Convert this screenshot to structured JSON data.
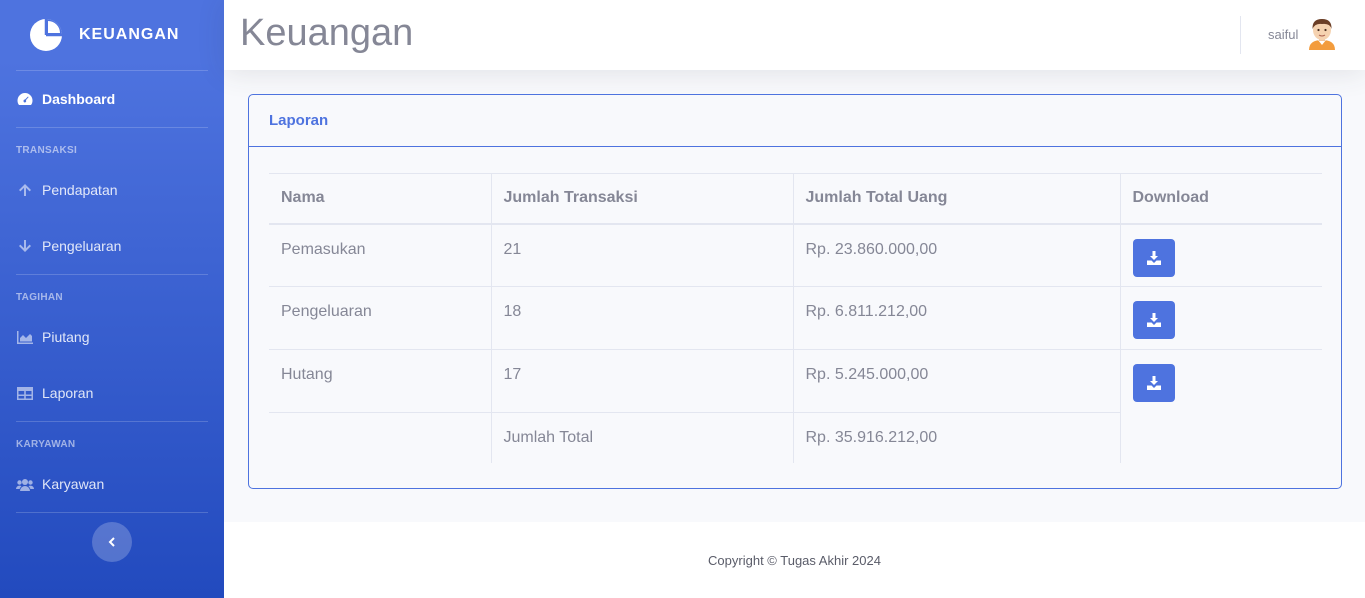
{
  "brand": {
    "name": "KEUANGAN",
    "icon": "pie-chart-icon"
  },
  "sidebar": {
    "dashboard": {
      "label": "Dashboard",
      "icon": "tachometer-icon"
    },
    "sections": [
      {
        "heading": "TRANSAKSI",
        "items": [
          {
            "label": "Pendapatan",
            "icon": "arrow-up-icon"
          },
          {
            "label": "Pengeluaran",
            "icon": "arrow-down-icon"
          }
        ]
      },
      {
        "heading": "TAGIHAN",
        "items": [
          {
            "label": "Piutang",
            "icon": "area-chart-icon"
          },
          {
            "label": "Laporan",
            "icon": "table-icon"
          }
        ]
      },
      {
        "heading": "KARYAWAN",
        "items": [
          {
            "label": "Karyawan",
            "icon": "users-icon"
          }
        ]
      }
    ],
    "toggle_icon": "chevron-left-icon"
  },
  "header": {
    "title": "Keuangan",
    "user_name": "saiful"
  },
  "card": {
    "title": "Laporan",
    "columns": [
      "Nama",
      "Jumlah Transaksi",
      "Jumlah Total Uang",
      "Download"
    ],
    "rows": [
      {
        "nama": "Pemasukan",
        "jumlah": "21",
        "total": "Rp. 23.860.000,00"
      },
      {
        "nama": "Pengeluaran",
        "jumlah": "18",
        "total": "Rp. 6.811.212,00"
      },
      {
        "nama": "Hutang",
        "jumlah": "17",
        "total": "Rp. 5.245.000,00"
      }
    ],
    "total_row": {
      "label": "Jumlah Total",
      "value": "Rp. 35.916.212,00"
    }
  },
  "footer": {
    "text": "Copyright © Tugas Akhir 2024"
  },
  "colors": {
    "primary": "#4e73df",
    "sidebar_end": "#224abe",
    "text_muted": "#858796"
  }
}
